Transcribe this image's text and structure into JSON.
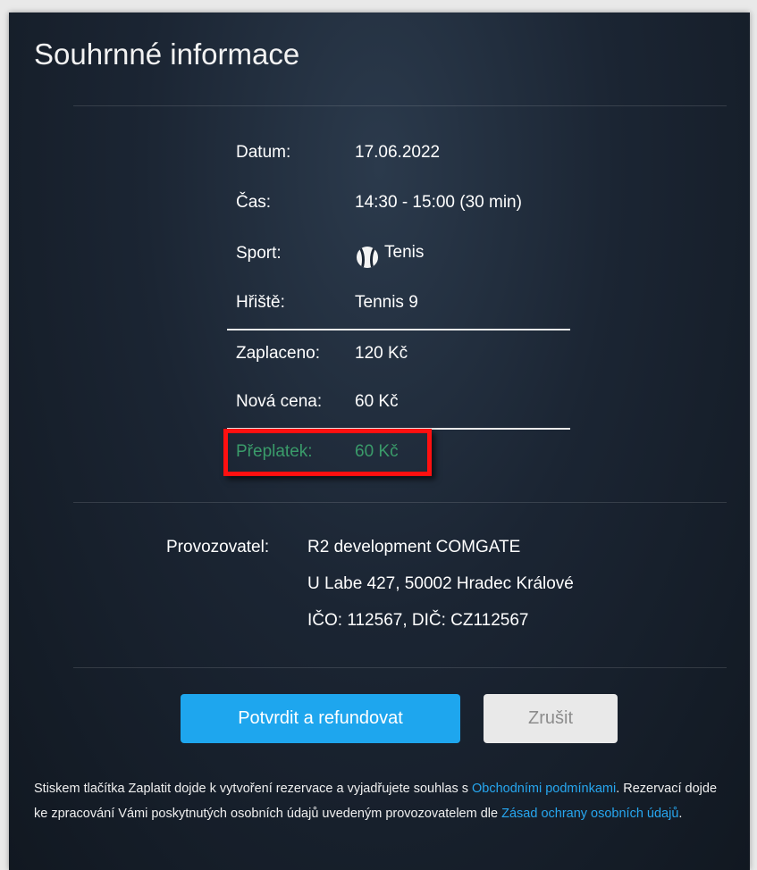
{
  "page": {
    "title": "Souhrnné informace"
  },
  "details": [
    {
      "label": "Datum:",
      "value": "17.06.2022"
    },
    {
      "label": "Čas:",
      "value": "14:30 - 15:00 (30 min)"
    },
    {
      "label": "Sport:",
      "value": "Tenis",
      "icon": "tennis-ball-icon"
    },
    {
      "label": "Hřiště:",
      "value": "Tennis 9"
    }
  ],
  "payment": {
    "paid_label": "Zaplaceno:",
    "paid_value": "120 Kč",
    "new_price_label": "Nová cena:",
    "new_price_value": "60 Kč",
    "overpay_label": "Přeplatek:",
    "overpay_value": "60 Kč",
    "overpay_color": "#3a9b6a",
    "highlight_color": "#ff1010"
  },
  "operator": {
    "label": "Provozovatel:",
    "lines": [
      "R2 development COMGATE",
      "U Labe 427, 50002 Hradec Králové",
      "IČO: 112567, DIČ: CZ112567"
    ]
  },
  "actions": {
    "confirm_label": "Potvrdit a refundovat",
    "cancel_label": "Zrušit",
    "confirm_color": "#1ea6ee"
  },
  "note": {
    "part1": "Stiskem tlačítka Zaplatit dojde k vytvoření rezervace a vyjadřujete souhlas s ",
    "link1": "Obchodními podmínkami",
    "part2": ". Rezervací dojde ke zpracování Vámi poskytnutých osobních údajů uvedeným provozovatelem dle ",
    "link2": "Zásad ochrany osobních údajů",
    "part3": "."
  }
}
